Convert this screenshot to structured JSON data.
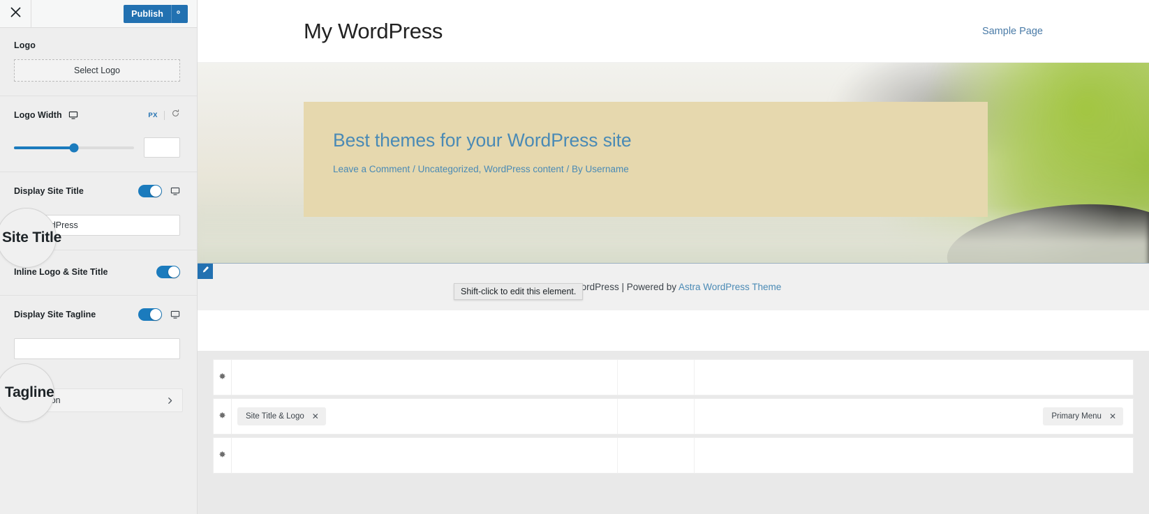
{
  "customizer": {
    "close_label": "Close",
    "publish_label": "Publish",
    "gear_label": "Publish settings",
    "sections": {
      "logo": {
        "title": "Logo",
        "select_logo_label": "Select Logo"
      },
      "logo_width": {
        "label": "Logo Width",
        "unit": "PX",
        "reset_label": "Reset",
        "responsive_label": "Desktop",
        "value": "",
        "slider_percent": 50
      },
      "display_site_title": {
        "label": "Display Site Title",
        "toggle_on": true,
        "responsive_label": "Desktop",
        "input_value": "My WordPress"
      },
      "inline_logo_site_title": {
        "label": "Inline Logo & Site Title",
        "toggle_on": true
      },
      "display_site_tagline": {
        "label": "Display Site Tagline",
        "toggle_on": true,
        "responsive_label": "Desktop",
        "input_value": ""
      },
      "site_icon": {
        "label": "Site Icon"
      }
    },
    "magnifiers": [
      {
        "label": "Site Title"
      },
      {
        "label": "Tagline"
      }
    ]
  },
  "preview": {
    "site_title": "My WordPress",
    "nav": [
      {
        "label": "Sample Page"
      }
    ],
    "post": {
      "title": "Best themes for your WordPress site",
      "meta_comment": "Leave a Comment",
      "meta_sep1": " / ",
      "meta_categories": "Uncategorized, WordPress content",
      "meta_sep2": " / ",
      "meta_author": "By Username"
    },
    "footer": {
      "text_before": "y WordPress | Powered by ",
      "link_label": "Astra WordPress Theme"
    },
    "tooltip": "Shift-click to edit this element.",
    "edit_label": "Edit"
  },
  "builder": {
    "rows": [
      {
        "gear_label": "Row settings",
        "left_items": [],
        "right_items": []
      },
      {
        "gear_label": "Row settings",
        "left_items": [
          {
            "label": "Site Title & Logo",
            "remove_label": "✕"
          }
        ],
        "right_items": [
          {
            "label": "Primary Menu",
            "remove_label": "✕"
          }
        ]
      },
      {
        "gear_label": "Row settings",
        "left_items": [],
        "right_items": []
      }
    ]
  },
  "colors": {
    "accent": "#2271b1",
    "toggle_on": "#1b7bbd",
    "hero_card": "#e6d8ae",
    "link": "#4a8ab5"
  }
}
